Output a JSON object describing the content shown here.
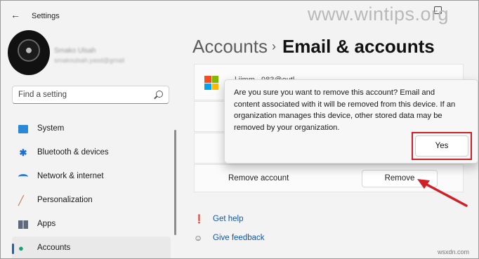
{
  "window": {
    "title": "Settings",
    "watermark": "www.wintips.org"
  },
  "profile": {
    "name": "Smako Ulsah",
    "email": "smakoulsah.yasd@gmail"
  },
  "search": {
    "placeholder": "Find a setting"
  },
  "sidebar": {
    "items": [
      {
        "label": "System",
        "icon": "system-icon"
      },
      {
        "label": "Bluetooth & devices",
        "icon": "bluetooth-icon"
      },
      {
        "label": "Network & internet",
        "icon": "wifi-icon"
      },
      {
        "label": "Personalization",
        "icon": "brush-icon"
      },
      {
        "label": "Apps",
        "icon": "apps-icon"
      },
      {
        "label": "Accounts",
        "icon": "accounts-icon",
        "active": true
      }
    ]
  },
  "breadcrumb": {
    "parent": "Accounts",
    "separator": "›",
    "current": "Email & accounts"
  },
  "account": {
    "email": "...l.jimm...983@outl..."
  },
  "remove_row": {
    "label": "Remove account",
    "button": "Remove"
  },
  "dialog": {
    "message": "Are you sure you want to remove this account? Email and content associated with it will be removed from this device. If an organization manages this device, other stored data may be removed by your organization.",
    "confirm_button": "Yes"
  },
  "links": {
    "help": "Get help",
    "feedback": "Give feedback"
  },
  "footer": {
    "source": "wsxdn.com"
  },
  "colors": {
    "accent": "#1a62b8",
    "annotation_red": "#d02027",
    "link": "#0b56b3",
    "ms_red": "#f25022",
    "ms_green": "#7fba00",
    "ms_blue": "#00a4ef",
    "ms_yellow": "#ffb900"
  }
}
